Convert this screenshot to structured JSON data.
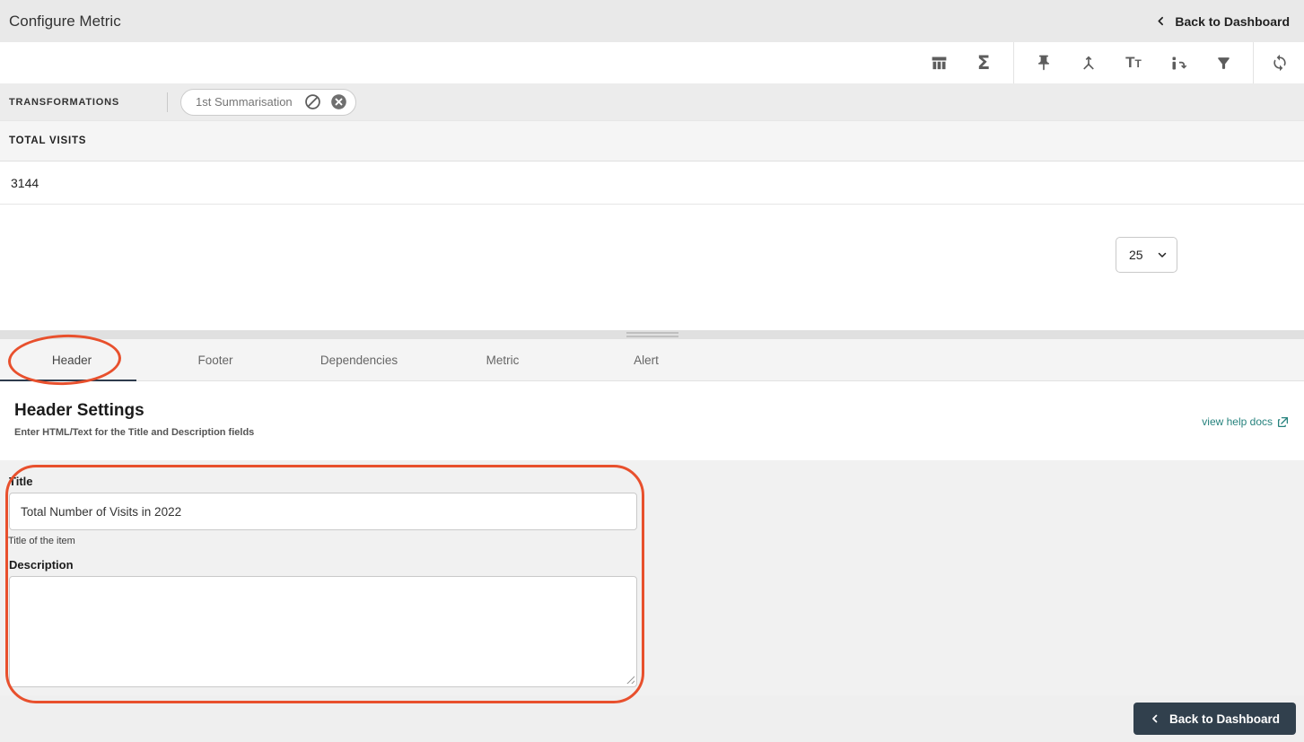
{
  "header": {
    "title": "Configure Metric",
    "back_label": "Back to Dashboard"
  },
  "toolbar": {
    "icons": [
      "table-columns-icon",
      "sigma-icon",
      "pin-icon",
      "merge-icon",
      "text-format-icon",
      "transform-icon",
      "filter-icon",
      "sync-icon"
    ],
    "sigma_glyph": "Σ"
  },
  "transformations": {
    "label": "TRANSFORMATIONS",
    "chip": {
      "label": "1st Summarisation",
      "icons": [
        "disable-icon",
        "remove-icon"
      ]
    }
  },
  "grid": {
    "column_header": "TOTAL VISITS",
    "rows": [
      "3144"
    ]
  },
  "pagination": {
    "page_size": "25"
  },
  "tabs": [
    {
      "label": "Header",
      "active": true
    },
    {
      "label": "Footer",
      "active": false
    },
    {
      "label": "Dependencies",
      "active": false
    },
    {
      "label": "Metric",
      "active": false
    },
    {
      "label": "Alert",
      "active": false
    }
  ],
  "section": {
    "title": "Header Settings",
    "subtitle": "Enter HTML/Text for the Title and Description fields",
    "help_link_label": "view help docs"
  },
  "form": {
    "title_label": "Title",
    "title_value": "Total Number of Visits in 2022",
    "title_helper": "Title of the item",
    "description_label": "Description",
    "description_value": ""
  },
  "footer": {
    "back_label": "Back to Dashboard"
  },
  "colors": {
    "annotation_red": "#e8502d",
    "link_teal": "#26827d",
    "button_dark": "#31404d",
    "tab_underline": "#2e3b4d",
    "icon_gray": "#5d5d5d"
  }
}
